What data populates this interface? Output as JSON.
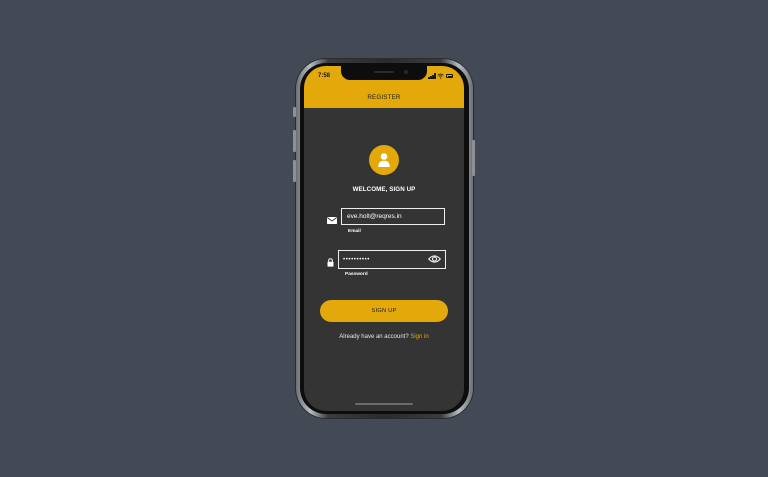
{
  "status_bar": {
    "time": "7:58",
    "icons": [
      "signal-icon",
      "wifi-icon",
      "battery-icon"
    ]
  },
  "header": {
    "title": "REGISTER"
  },
  "avatar": {
    "icon": "user-icon"
  },
  "welcome": {
    "text": "WELCOME, SIGN UP"
  },
  "email": {
    "icon": "mail-icon",
    "value": "eve.holt@reqres.in",
    "label": "Email"
  },
  "password": {
    "icon": "lock-icon",
    "value": "cityslicka",
    "label": "Password",
    "toggle_icon": "eye-icon"
  },
  "signup_button": {
    "label": "SIGN UP"
  },
  "footer": {
    "prompt": "Already have an account?",
    "link": "Sign in"
  },
  "colors": {
    "background": "#434a55",
    "screen": "#343434",
    "accent": "#e3a80a",
    "text": "#ffffff"
  }
}
